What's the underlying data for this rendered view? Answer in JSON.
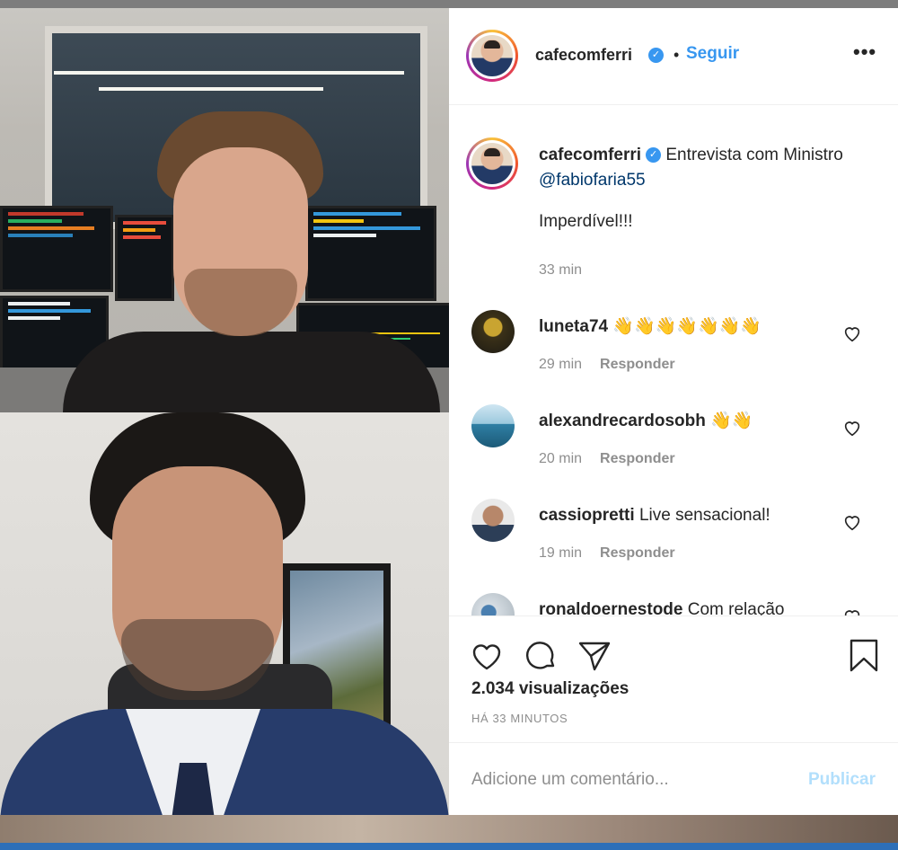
{
  "post": {
    "username": "cafecomferri",
    "follow_label": "Seguir",
    "separator": "•",
    "more_label": "•••",
    "verified_glyph": "✓",
    "caption_text": "Entrevista com Ministro",
    "caption_mention": "@fabiofaria55",
    "caption_extra": "Imperdível!!!",
    "caption_time": "33 min"
  },
  "comments": [
    {
      "user": "luneta74",
      "text": "👋👋👋👋👋👋👋",
      "time": "29 min",
      "reply": "Responder"
    },
    {
      "user": "alexandrecardosobh",
      "text": "👋👋",
      "time": "20 min",
      "reply": "Responder"
    },
    {
      "user": "cassiopretti",
      "text": "Live sensacional!",
      "time": "19 min",
      "reply": "Responder"
    },
    {
      "user": "ronaldoernestode",
      "text": "Com relação"
    }
  ],
  "stats": {
    "views": "2.034 visualizações",
    "posted_ago": "HÁ 33 MINUTOS"
  },
  "comment_box": {
    "placeholder": "Adicione um comentário...",
    "publish_label": "Publicar"
  },
  "colors": {
    "accent": "#3897f0",
    "publish_disabled": "#b2dffc",
    "text": "#262626",
    "muted": "#8e8e8e"
  },
  "icons": [
    "heart-icon",
    "comment-icon",
    "share-icon",
    "bookmark-icon",
    "more-options-icon",
    "verified-icon"
  ]
}
